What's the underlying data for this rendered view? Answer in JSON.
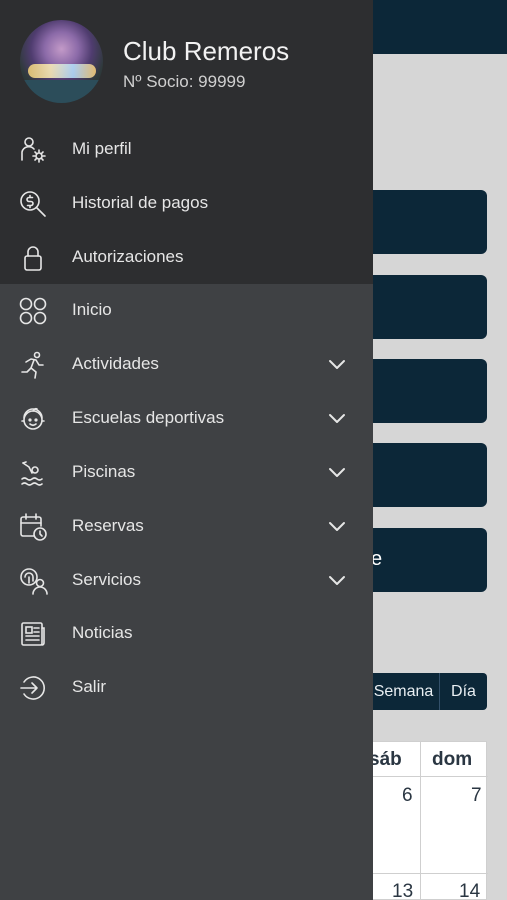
{
  "profile": {
    "club_name": "Club Remeros",
    "member_number": "Nº Socio: 99999"
  },
  "menu": {
    "account_items": [
      {
        "label": "Mi perfil",
        "icon": "profile-settings-icon"
      },
      {
        "label": "Historial de pagos",
        "icon": "payment-search-icon"
      },
      {
        "label": "Autorizaciones",
        "icon": "lock-icon"
      }
    ],
    "main_items": [
      {
        "label": "Inicio",
        "icon": "grid-circles-icon",
        "expandable": false
      },
      {
        "label": "Actividades",
        "icon": "runner-icon",
        "expandable": true
      },
      {
        "label": "Escuelas deportivas",
        "icon": "kid-face-icon",
        "expandable": true
      },
      {
        "label": "Piscinas",
        "icon": "swimmer-icon",
        "expandable": true
      },
      {
        "label": "Reservas",
        "icon": "calendar-clock-icon",
        "expandable": true
      },
      {
        "label": "Servicios",
        "icon": "services-people-icon",
        "expandable": true
      },
      {
        "label": "Noticias",
        "icon": "newspaper-icon",
        "expandable": false
      },
      {
        "label": "Salir",
        "icon": "logout-icon",
        "expandable": false
      }
    ]
  },
  "background": {
    "card_partial_text": "e",
    "calendar": {
      "view_tabs": [
        "Semana",
        "Día"
      ],
      "headers": [
        "sáb",
        "dom"
      ],
      "week1": [
        "6",
        "7"
      ],
      "week2": [
        "13",
        "14"
      ]
    }
  },
  "colors": {
    "drawer_top": "#2d2e30",
    "drawer_bottom": "#3f4144",
    "app_navy": "#0c2738"
  }
}
